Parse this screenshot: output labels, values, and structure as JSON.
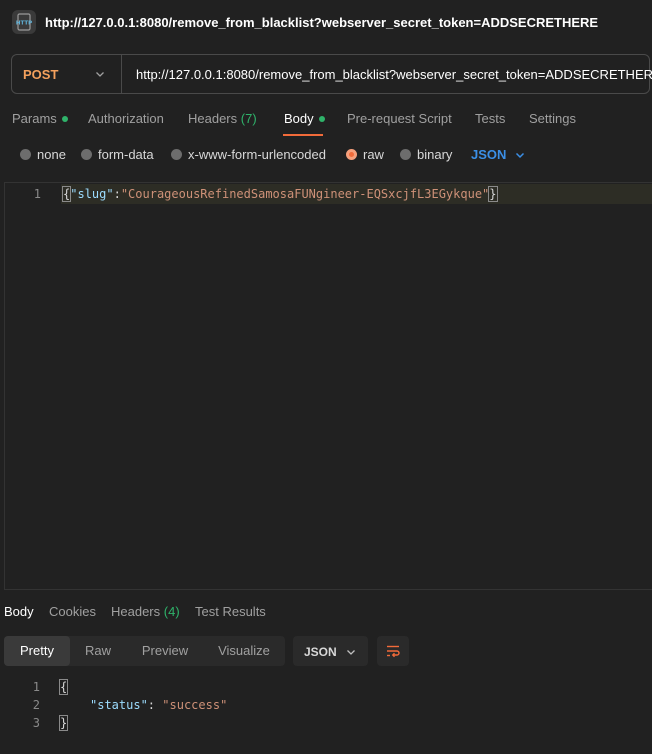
{
  "window": {
    "title": "http://127.0.0.1:8080/remove_from_blacklist?webserver_secret_token=ADDSECRETHERE",
    "icon": "http-icon",
    "icon_text": "HTTP"
  },
  "request": {
    "method": "POST",
    "url": "http://127.0.0.1:8080/remove_from_blacklist?webserver_secret_token=ADDSECRETHERE"
  },
  "request_tabs": [
    {
      "label": "Params",
      "dot": true
    },
    {
      "label": "Authorization"
    },
    {
      "label": "Headers",
      "count": "(7)"
    },
    {
      "label": "Body",
      "dot": true,
      "active": true
    },
    {
      "label": "Pre-request Script"
    },
    {
      "label": "Tests"
    },
    {
      "label": "Settings"
    }
  ],
  "body_types": [
    {
      "label": "none",
      "selected": false
    },
    {
      "label": "form-data",
      "selected": false
    },
    {
      "label": "x-www-form-urlencoded",
      "selected": false
    },
    {
      "label": "raw",
      "selected": true
    },
    {
      "label": "binary",
      "selected": false
    }
  ],
  "body_format": "JSON",
  "editor": {
    "line_number": "1",
    "open_brace": "{",
    "key": "\"slug\"",
    "colon": ":",
    "value": "\"CourageousRefinedSamosaFUNgineer-EQSxcjfL3EGykque\"",
    "close_brace": "}"
  },
  "response_tabs": [
    {
      "label": "Body",
      "active": true
    },
    {
      "label": "Cookies"
    },
    {
      "label": "Headers",
      "count": "(4)"
    },
    {
      "label": "Test Results"
    }
  ],
  "response_views": [
    {
      "label": "Pretty",
      "active": true
    },
    {
      "label": "Raw"
    },
    {
      "label": "Preview"
    },
    {
      "label": "Visualize"
    }
  ],
  "response_format": "JSON",
  "response_body": {
    "line_numbers": [
      "1",
      "2",
      "3"
    ],
    "open_brace": "{",
    "key": "\"status\"",
    "colon": ":",
    "value": "\"success\"",
    "close_brace": "}"
  },
  "colors": {
    "accent": "#f26b3a",
    "method": "#f4a15d",
    "json_link": "#3b8fe6",
    "success_dot": "#2fb36a"
  }
}
